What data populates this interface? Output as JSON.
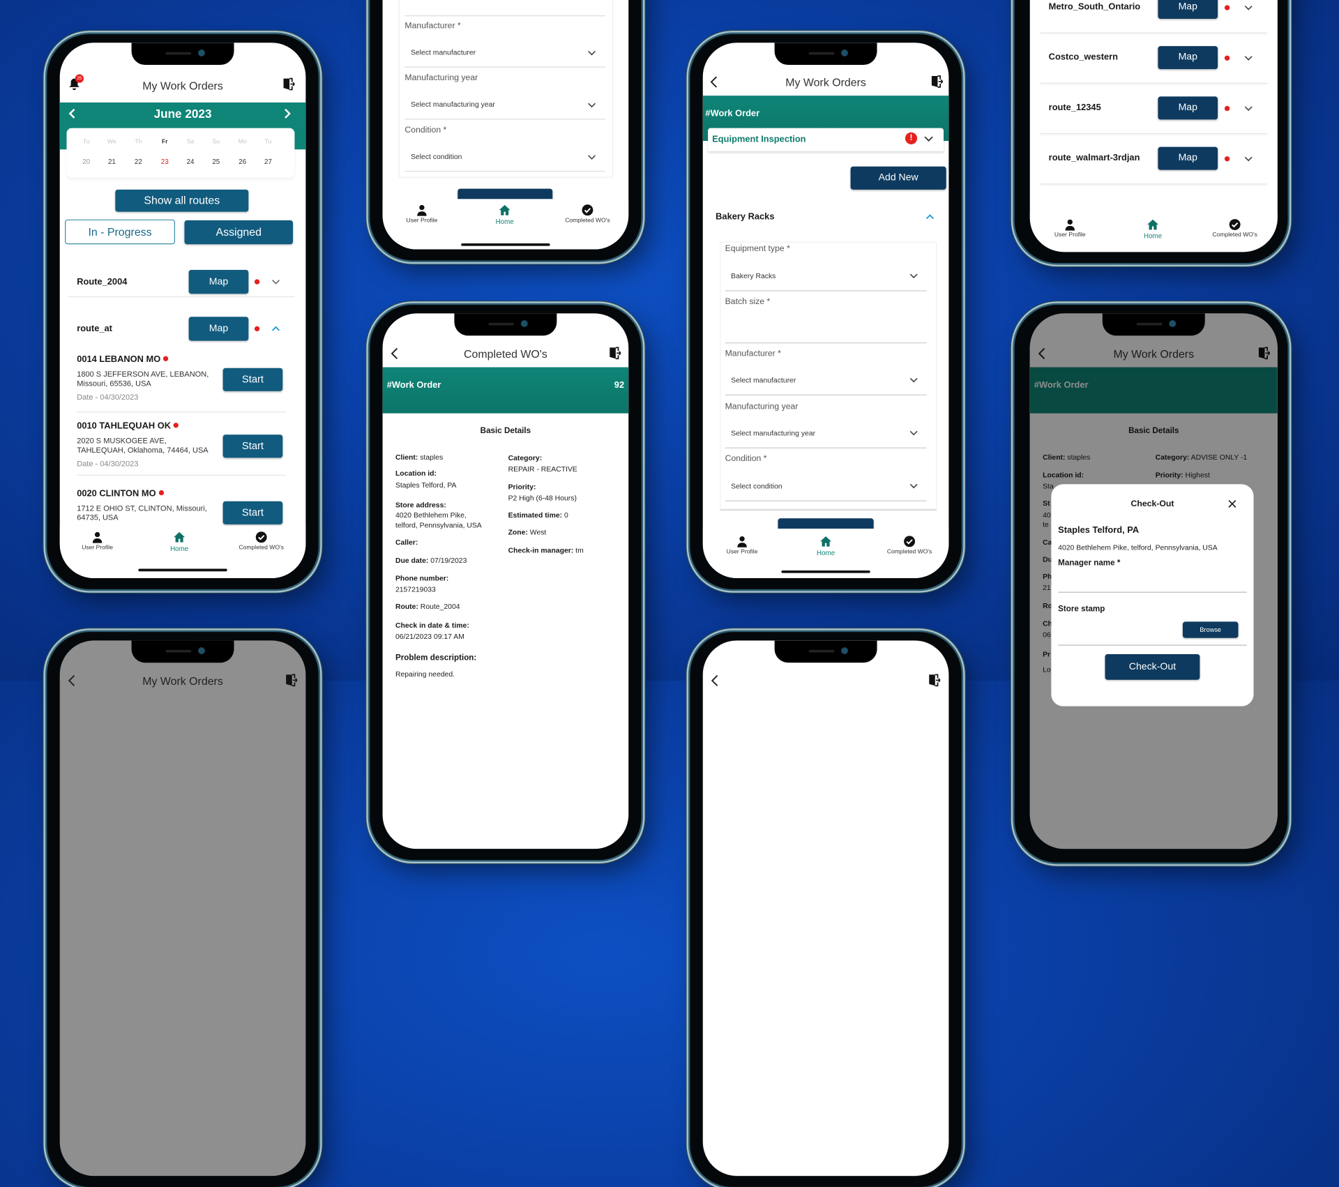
{
  "colors": {
    "background": "#0a3ea3",
    "teal": "#0f8577",
    "button": "#115b7e",
    "navy": "#0e3a5f",
    "alert": "#e5201e"
  },
  "nav": {
    "user_profile": "User Profile",
    "home": "Home",
    "completed": "Completed WO's"
  },
  "phone1": {
    "title": "My Work Orders",
    "notification_count": "25",
    "month": "June 2023",
    "weekdays": [
      "Tu",
      "We",
      "Th",
      "Fr",
      "Sa",
      "Su",
      "Mo",
      "Tu"
    ],
    "dates": [
      "20",
      "21",
      "22",
      "23",
      "24",
      "25",
      "26",
      "27"
    ],
    "selected_date": "23",
    "show_all_routes": "Show all routes",
    "tabs": {
      "in_progress": "In - Progress",
      "assigned": "Assigned",
      "active": "Assigned"
    },
    "routes": [
      {
        "name": "Route_2004",
        "map": "Map",
        "expanded": false
      },
      {
        "name": "route_at",
        "map": "Map",
        "expanded": true
      }
    ],
    "stops": [
      {
        "name": "0014 LEBANON MO",
        "addr1": "1800 S JEFFERSON AVE, LEBANON,",
        "addr2": "Missouri, 65536, USA",
        "date": "Date - 04/30/2023",
        "action": "Start"
      },
      {
        "name": "0010 TAHLEQUAH OK",
        "addr1": "2020 S MUSKOGEE AVE,",
        "addr2": "TAHLEQUAH, Oklahoma, 74464, USA",
        "date": "Date - 04/30/2023",
        "action": "Start"
      },
      {
        "name": "0020 CLINTON MO",
        "addr1": "1712 E OHIO ST, CLINTON, Missouri,",
        "addr2": "64735, USA",
        "action": "Start"
      }
    ]
  },
  "phone2": {
    "fields": [
      {
        "label": "Manufacturer *",
        "value": "Select manufacturer"
      },
      {
        "label": "Manufacturing year",
        "value": "Select manufacturing year"
      },
      {
        "label": "Condition *",
        "value": "Select condition"
      }
    ]
  },
  "phone3": {
    "title": "Completed WO's",
    "band_label": "#Work Order",
    "band_count": "92",
    "section": "Basic Details",
    "left": [
      {
        "label": "Client:",
        "value": " staples"
      },
      {
        "label": "Location id:",
        "value": "Staples Telford, PA"
      },
      {
        "label": "Store address:",
        "value": "4020 Bethlehem Pike,",
        "value2": "telford, Pennsylvania, USA"
      },
      {
        "label": "Caller:"
      },
      {
        "label": "Due date:",
        "value": " 07/19/2023"
      },
      {
        "label": "Phone number:",
        "value": "2157219033"
      },
      {
        "label": "Route:",
        "value": " Route_2004"
      },
      {
        "label": "Check in date & time:",
        "value": "06/21/2023 09:17 AM"
      },
      {
        "label": "Problem description:",
        "value": "Repairing needed."
      }
    ],
    "right": [
      {
        "label": "Category:",
        "value": "REPAIR - REACTIVE"
      },
      {
        "label": "Priority:",
        "value": "P2 High (6-48 Hours)"
      },
      {
        "label": "Estimated time:",
        "value": " 0"
      },
      {
        "label": "Zone:",
        "value": " West"
      },
      {
        "label": "Check-in manager:",
        "value": " tm"
      }
    ]
  },
  "phone4": {
    "title": "My Work Orders",
    "band_label": "#Work Order",
    "inspection": "Equipment Inspection",
    "add_new": "Add New",
    "section": "Bakery Racks",
    "fields": [
      {
        "label": "Equipment type *",
        "value": "Bakery Racks"
      },
      {
        "label": "Batch size *",
        "value": ""
      },
      {
        "label": "Manufacturer *",
        "value": "Select manufacturer"
      },
      {
        "label": "Manufacturing year",
        "value": "Select manufacturing year"
      },
      {
        "label": "Condition *",
        "value": "Select condition"
      }
    ]
  },
  "phone5": {
    "routes": [
      {
        "name": "Metro_South_Ontario",
        "map": "Map"
      },
      {
        "name": "Costco_western",
        "map": "Map"
      },
      {
        "name": "route_12345",
        "map": "Map"
      },
      {
        "name": "route_walmart-3rdjan",
        "map": "Map"
      }
    ]
  },
  "phone6": {
    "title": "My Work Orders",
    "band_label": "#Work Order",
    "section": "Basic Details",
    "client": {
      "label": "Client:",
      "value": " staples"
    },
    "location": {
      "label": "Location id:"
    },
    "category": {
      "label": "Category:",
      "value": " ADVISE ONLY -1"
    },
    "priority": {
      "label": "Priority:",
      "value": " Highest"
    },
    "fragments": [
      "Sta",
      "St",
      "40",
      "te",
      "Ca",
      "Du",
      "Ph",
      "21",
      "Ro",
      "Ch",
      "06",
      "Pr",
      "Lo"
    ],
    "modal": {
      "title": "Check-Out",
      "store": "Staples Telford, PA",
      "address": "4020 Bethlehem Pike, telford, Pennsylvania, USA",
      "manager_label": "Manager name *",
      "manager_value": "",
      "stamp_label": "Store stamp",
      "browse": "Browse",
      "submit": "Check-Out"
    }
  },
  "phone7": {
    "title": "My Work Orders"
  }
}
